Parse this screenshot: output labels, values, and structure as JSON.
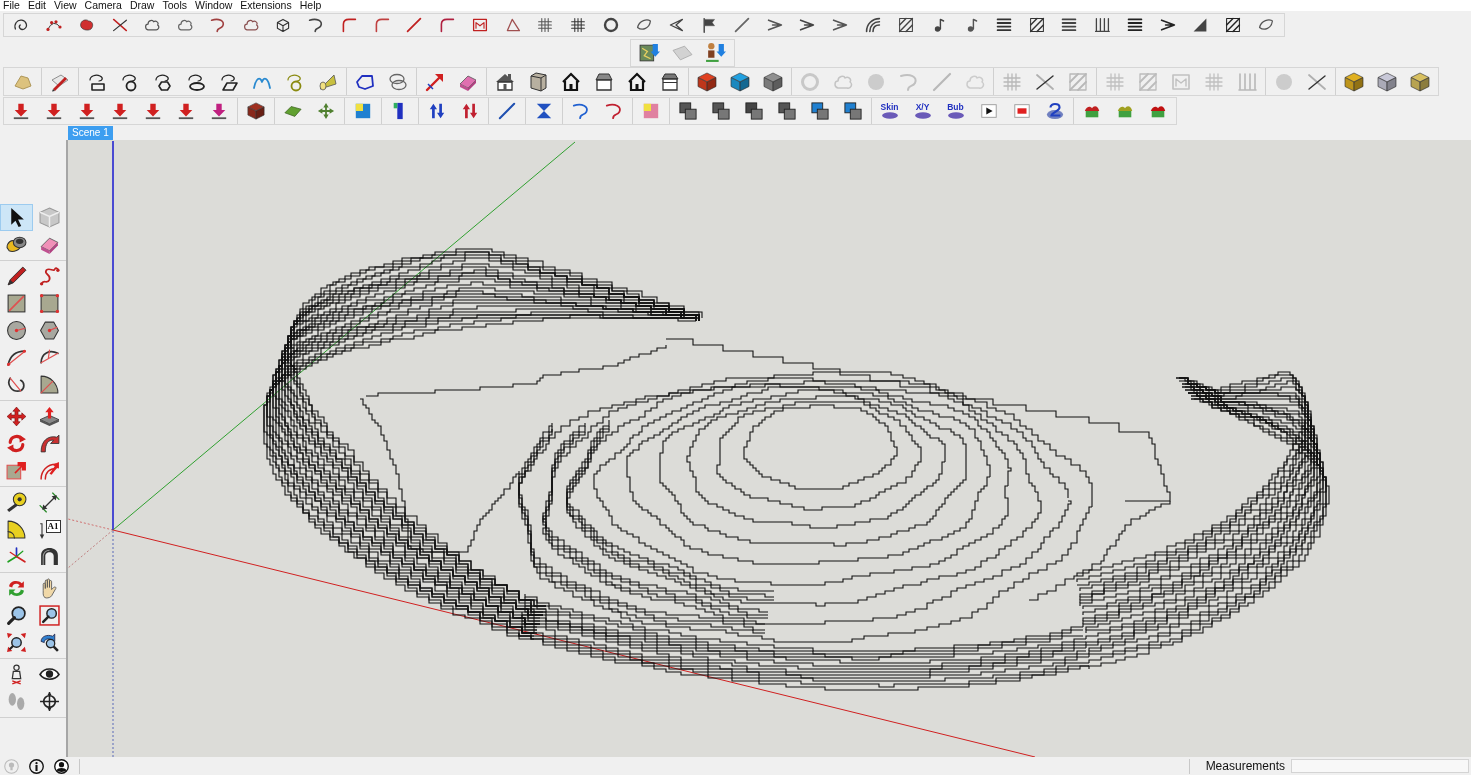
{
  "menu_bar": {
    "items": [
      "File",
      "Edit",
      "View",
      "Camera",
      "Draw",
      "Tools",
      "Window",
      "Extensions",
      "Help"
    ]
  },
  "toolbars": {
    "text_buttons": [
      {
        "label": "Skin"
      },
      {
        "label": "X/Y"
      },
      {
        "label": "Bub"
      }
    ]
  },
  "scene_tabs": [
    {
      "label": "Scene 1",
      "selected": true
    }
  ],
  "tool_palette": [
    {
      "selected": true
    },
    {
      "selected": false
    },
    {
      "selected": false
    },
    {
      "selected": false
    },
    {
      "selected": false
    },
    {
      "selected": false
    },
    {
      "selected": false
    },
    {
      "selected": false
    },
    {
      "selected": false
    },
    {
      "selected": false
    },
    {
      "selected": false
    },
    {
      "selected": false
    },
    {
      "selected": false
    },
    {
      "selected": false
    },
    {
      "selected": false
    },
    {
      "selected": false
    },
    {
      "selected": false
    },
    {
      "selected": false
    },
    {
      "selected": false
    },
    {
      "selected": false
    },
    {
      "selected": false
    },
    {
      "selected": false
    },
    {
      "selected": false
    },
    {
      "selected": false,
      "label": "A1"
    },
    {
      "selected": false
    },
    {
      "selected": false
    },
    {
      "selected": false
    },
    {
      "selected": false
    },
    {
      "selected": false
    },
    {
      "selected": false
    },
    {
      "selected": false
    },
    {
      "selected": false
    },
    {
      "selected": false
    },
    {
      "selected": false
    },
    {
      "selected": false
    },
    {
      "selected": false
    }
  ],
  "status_bar": {
    "measurements_label": "Measurements"
  }
}
